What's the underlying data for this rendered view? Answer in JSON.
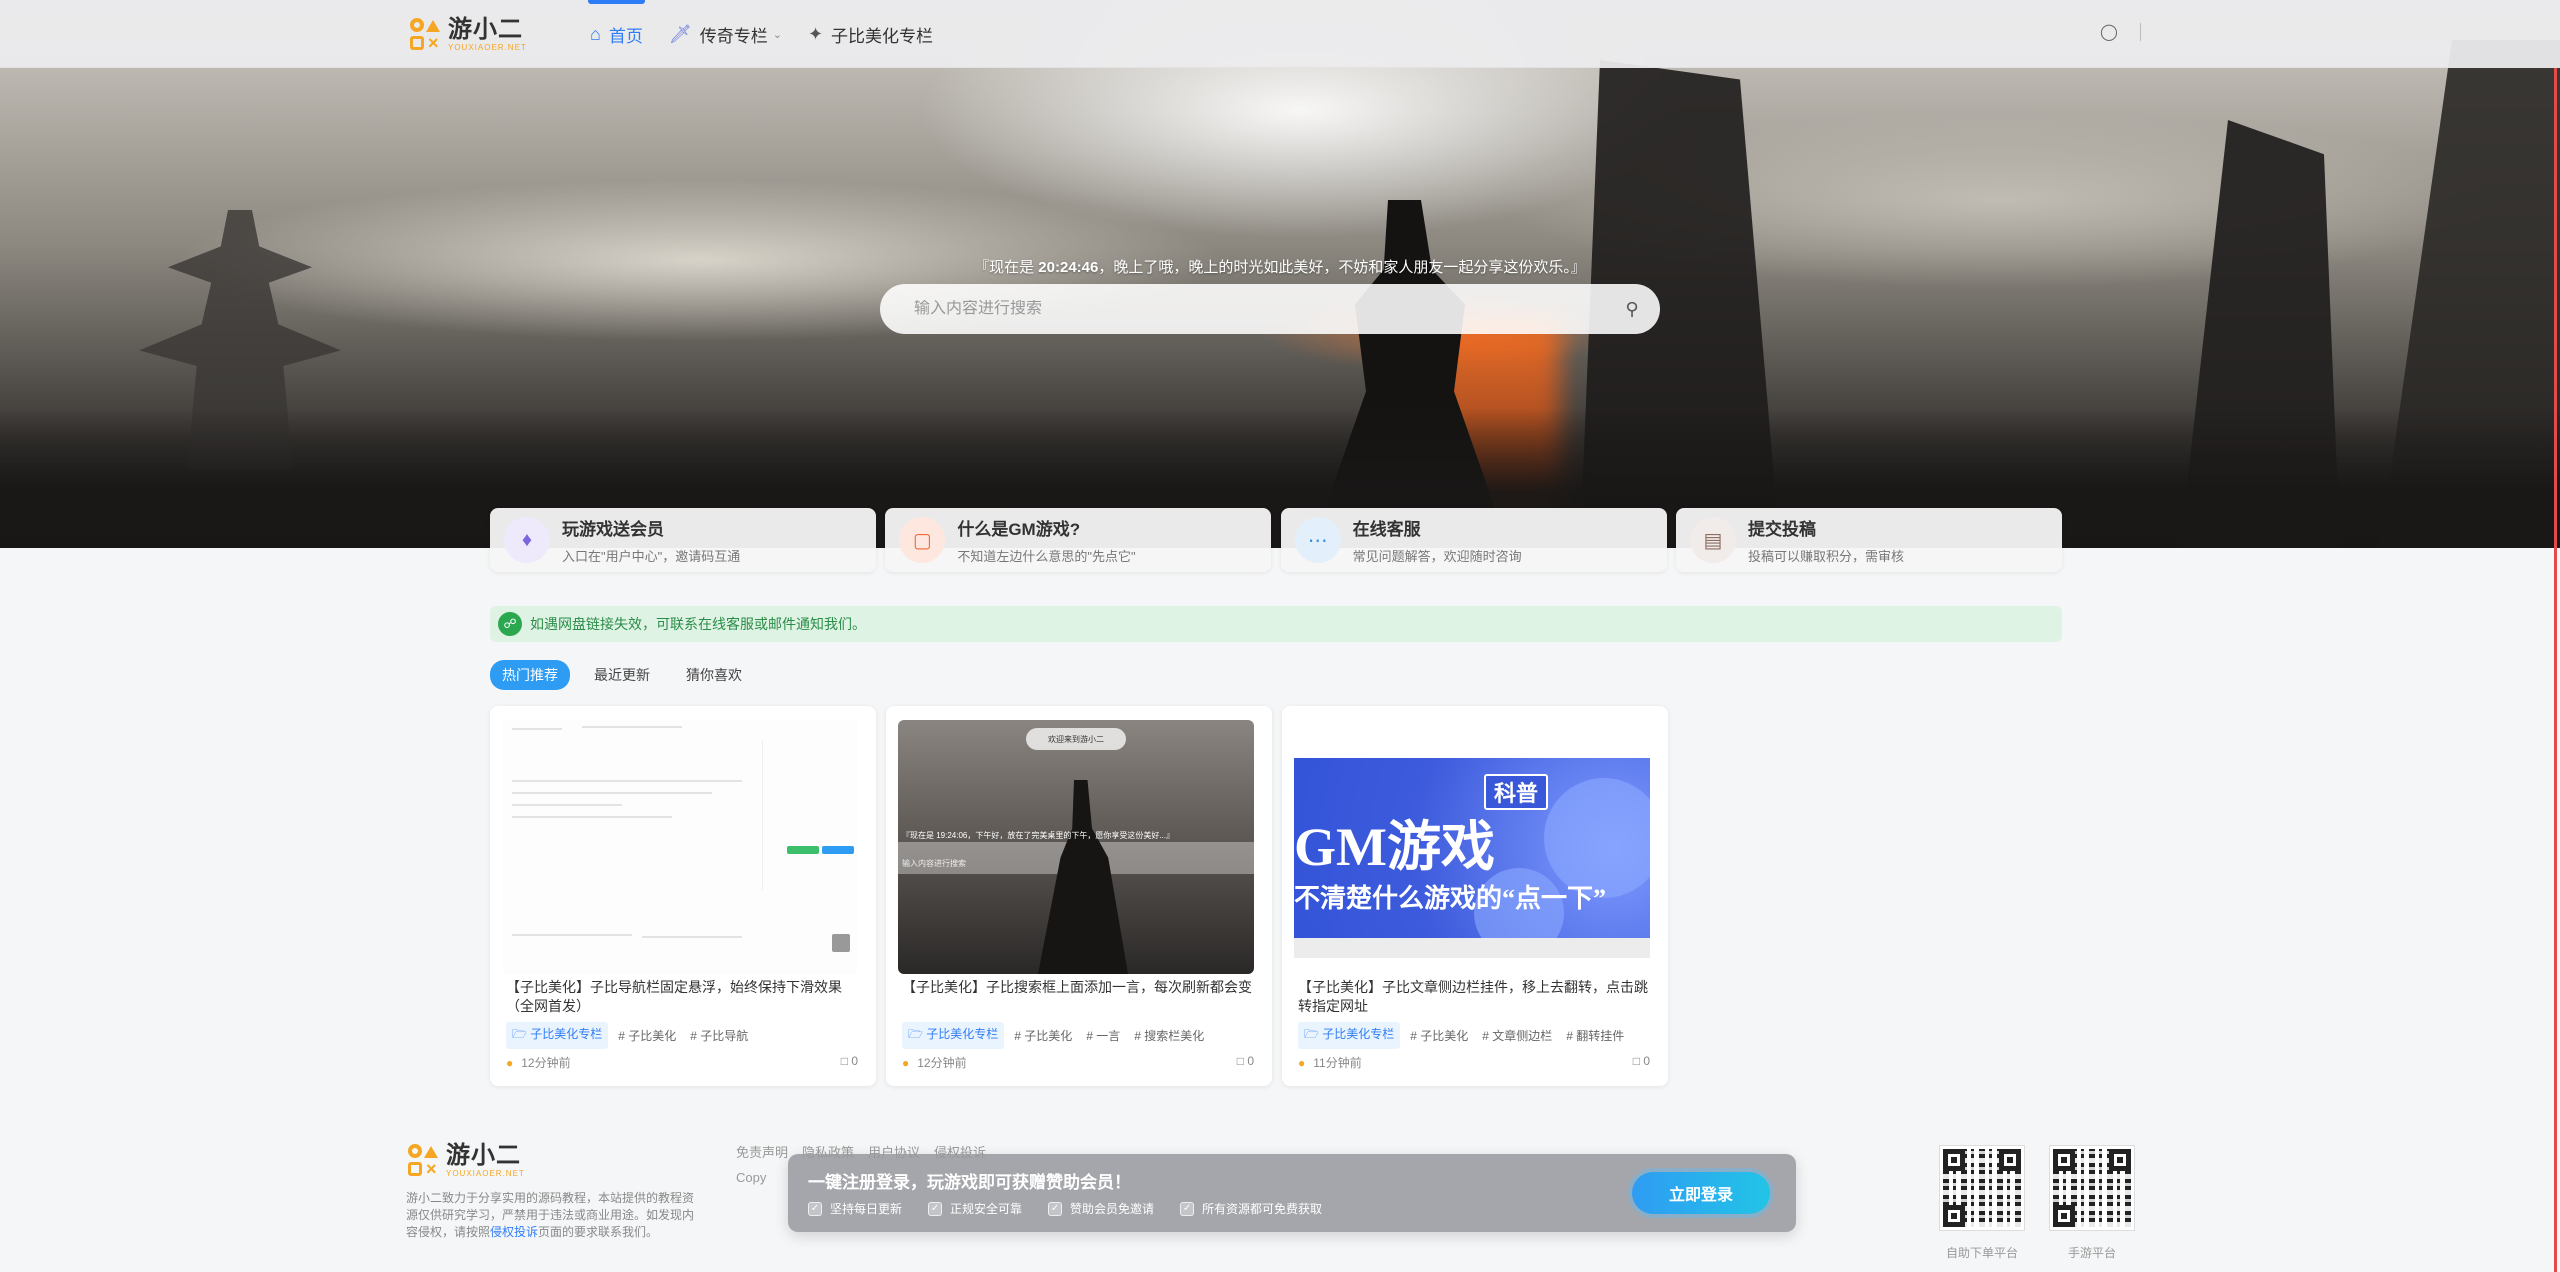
{
  "header": {
    "logo_name": "游小二",
    "logo_sub": "YOUXIAOER.NET",
    "nav": [
      {
        "label": "首页",
        "icon": "home-icon",
        "active": true
      },
      {
        "label": "传奇专栏",
        "icon": "sword-icon",
        "dropdown": true
      },
      {
        "label": "子比美化专栏",
        "icon": "magic-wand-icon"
      }
    ]
  },
  "hero": {
    "quote_prefix": "『现在是 ",
    "quote_time": "20:24:46",
    "quote_suffix": "，晚上了哦，晚上的时光如此美好，不妨和家人朋友一起分享这份欢乐。』",
    "search_placeholder": "输入内容进行搜索"
  },
  "features": [
    {
      "title": "玩游戏送会员",
      "desc": "入口在\"用户中心\"，邀请码互通",
      "icon": "diamond-icon",
      "bg": "#eeeafc",
      "color": "#7a66e0"
    },
    {
      "title": "什么是GM游戏?",
      "desc": "不知道左边什么意思的\"先点它\"",
      "icon": "twitch-icon",
      "bg": "#fde7df",
      "color": "#f26b3a"
    },
    {
      "title": "在线客服",
      "desc": "常见问题解答，欢迎随时咨询",
      "icon": "chat-icon",
      "bg": "#e3f0fb",
      "color": "#3a8fe0"
    },
    {
      "title": "提交投稿",
      "desc": "投稿可以赚取积分，需审核",
      "icon": "document-icon",
      "bg": "#f1ebe9",
      "color": "#8a6e64"
    }
  ],
  "notice": {
    "text": "如遇网盘链接失效，可联系在线客服或邮件通知我们。"
  },
  "tabs": [
    {
      "label": "热门推荐",
      "active": true
    },
    {
      "label": "最近更新"
    },
    {
      "label": "猜你喜欢"
    }
  ],
  "posts": [
    {
      "title": "【子比美化】子比导航栏固定悬浮，始终保持下滑效果（全网首发）",
      "category": "子比美化专栏",
      "tags": [
        "# 子比美化",
        "# 子比导航"
      ],
      "time": "12分钟前",
      "comments": "0"
    },
    {
      "title": "【子比美化】子比搜索框上面添加一言，每次刷新都会变",
      "category": "子比美化专栏",
      "tags": [
        "# 子比美化",
        "# 一言",
        "# 搜索栏美化"
      ],
      "time": "12分钟前",
      "comments": "0",
      "thumb_pill": "欢迎来到游小二",
      "thumb_quote": "『现在是 19:24:06，下午好，放在了完美桌里的下午，愿你享受这份美好...』",
      "thumb_search": "输入内容进行搜索"
    },
    {
      "title": "【子比美化】子比文章侧边栏挂件，移上去翻转，点击跳转指定网址",
      "category": "子比美化专栏",
      "tags": [
        "# 子比美化",
        "# 文章侧边栏",
        "# 翻转挂件"
      ],
      "time": "11分钟前",
      "comments": "0",
      "thumb_badge": "科普",
      "thumb_title": "GM游戏",
      "thumb_subtitle": "不清楚什么游戏的“点一下”"
    }
  ],
  "footer": {
    "logo_name": "游小二",
    "logo_sub": "YOUXIAOER.NET",
    "desc_before": "游小二致力于分享实用的源码教程，本站提供的教程资源仅供研究学习，严禁用于违法或商业用途。如发现内容侵权，请按照",
    "desc_link": "侵权投诉",
    "desc_after": "页面的要求联系我们。",
    "links": [
      "免责声明",
      "隐私政策",
      "用户协议",
      "侵权投诉"
    ],
    "copy": "Copy",
    "qr": [
      {
        "label": "自助下单平台"
      },
      {
        "label": "手游平台"
      }
    ]
  },
  "popup": {
    "title": "一键注册登录，玩游戏即可获赠赞助会员！",
    "checks": [
      "坚持每日更新",
      "正规安全可靠",
      "赞助会员免邀请",
      "所有资源都可免费获取"
    ],
    "button": "立即登录"
  },
  "colors": {
    "accent": "#2f7df6",
    "brand": "#f5a623",
    "success": "#2a8d48"
  }
}
